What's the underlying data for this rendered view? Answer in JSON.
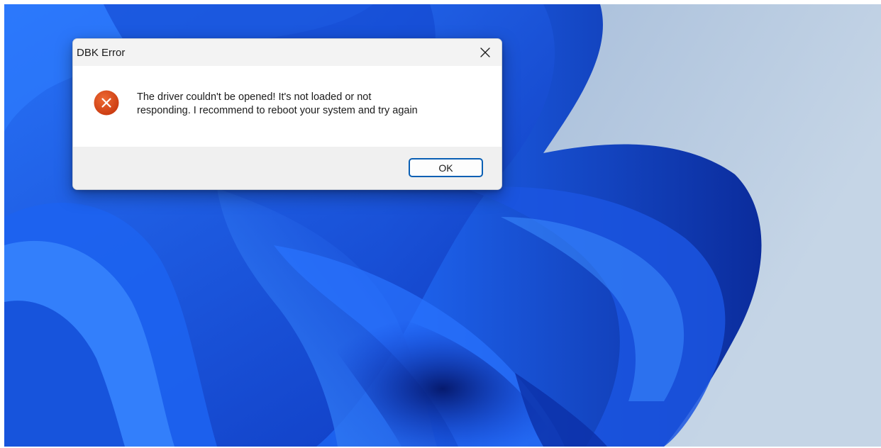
{
  "dialog": {
    "title": "DBK Error",
    "close_icon": "close-icon",
    "error_icon": "error-icon",
    "message_line1": "The driver couldn't be opened! It's not loaded or not",
    "message_line2": "responding. I recommend to reboot your system and try again",
    "ok_label": "OK"
  },
  "colors": {
    "error_red": "#d8461c",
    "accent_blue": "#0a5fb4",
    "wallpaper_blue": "#1e5fe6",
    "wallpaper_bg": "#b7cbe0"
  }
}
